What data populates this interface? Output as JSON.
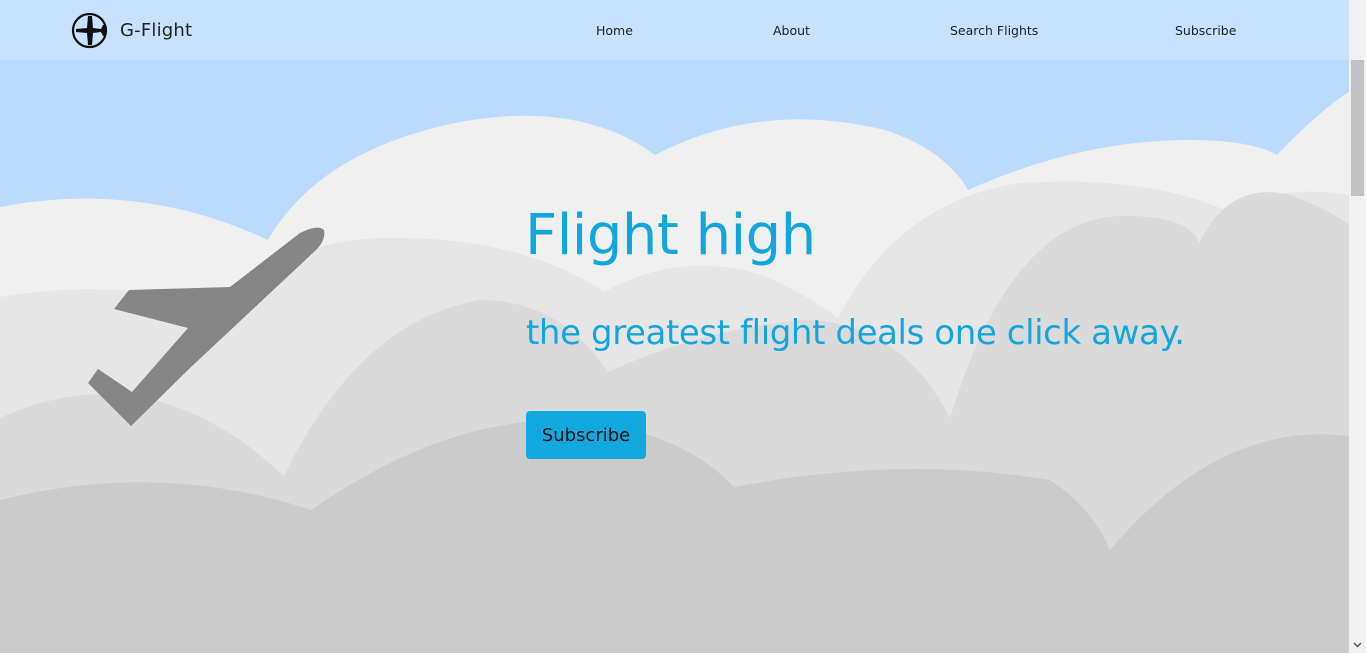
{
  "navbar": {
    "brand_name": "G-Flight",
    "brand_icon": "airplane-logo-icon",
    "links": {
      "home": "Home",
      "about": "About",
      "search_flights": "Search Flights",
      "subscribe": "Subscribe"
    }
  },
  "hero": {
    "title": "Flight high",
    "subtitle": "the greatest flight deals one click away.",
    "button_label": "Subscribe",
    "illustration_icon": "airplane-icon"
  },
  "colors": {
    "accent": "#13a6dc",
    "sky": "#badbfe",
    "navbar": "#c7e1fe",
    "cloud_light": "#f0f0f0",
    "cloud_mid": "#e6e6e6",
    "cloud_darker": "#dadada",
    "cloud_darkest": "#cccbcc",
    "plane": "#808080"
  }
}
